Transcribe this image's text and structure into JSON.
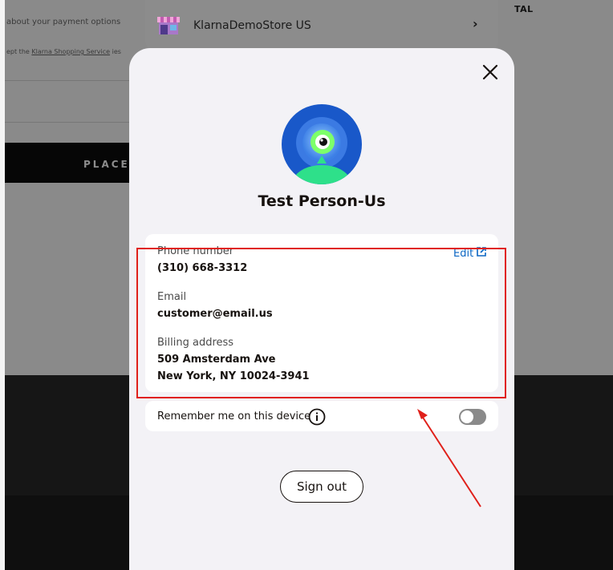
{
  "background": {
    "payment_text": "about your payment options",
    "service_text_prefix": "ept the",
    "service_link": "Klarna Shopping Service",
    "service_text_suffix": "ies",
    "place_order": "PLACE",
    "total_label": "TAL"
  },
  "store": {
    "name": "KlarnaDemoStore US",
    "icon": "store-icon",
    "chevron": "chevron-right-icon"
  },
  "modal": {
    "close_icon": "close-icon",
    "avatar_icon": "alien-avatar-icon",
    "person_name": "Test Person-Us",
    "phone": {
      "label": "Phone number",
      "value": "(310) 668-3312"
    },
    "edit_label": "Edit",
    "email": {
      "label": "Email",
      "value": "customer@email.us"
    },
    "billing": {
      "label": "Billing address",
      "line1": "509 Amsterdam Ave",
      "line2": "New York, NY 10024-3941"
    },
    "remember_label": "Remember me on this device",
    "remember_enabled": false,
    "signout_label": "Sign out"
  },
  "colors": {
    "accent_link": "#0b66c3",
    "highlight": "#e0201a",
    "modal_bg": "#f3f2f6"
  }
}
